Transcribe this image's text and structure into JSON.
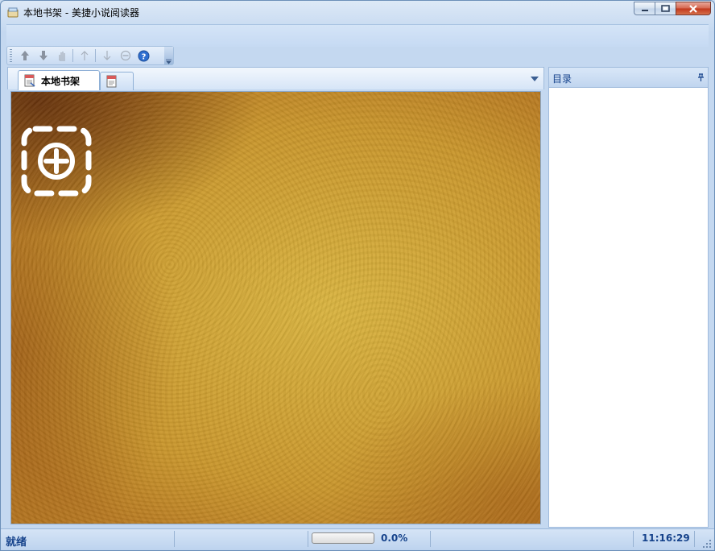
{
  "window": {
    "title": "本地书架 - 美捷小说阅读器",
    "icon": "app-book-icon"
  },
  "caption_buttons": [
    "minimize-icon",
    "maximize-icon",
    "close-icon"
  ],
  "toolbar": {
    "buttons": [
      "arrow-up-icon",
      "arrow-down-icon",
      "hand-icon",
      "thin-arrow-up-icon",
      "thin-arrow-down-icon",
      "minus-circle-icon",
      "help-icon"
    ]
  },
  "tabs": [
    {
      "label": "本地书架",
      "icon": "doc-icon",
      "active": true
    },
    {
      "label": "",
      "icon": "doc-icon",
      "active": false
    }
  ],
  "toc_panel": {
    "title": "目录"
  },
  "statusbar": {
    "status": "就绪",
    "progress_text": "0.0%",
    "progress_fraction": 0.0,
    "clock": "11:16:29"
  },
  "colors": {
    "accent_text": "#15428b",
    "frame": "#c4d8f0",
    "close_button": "#c1371c"
  }
}
